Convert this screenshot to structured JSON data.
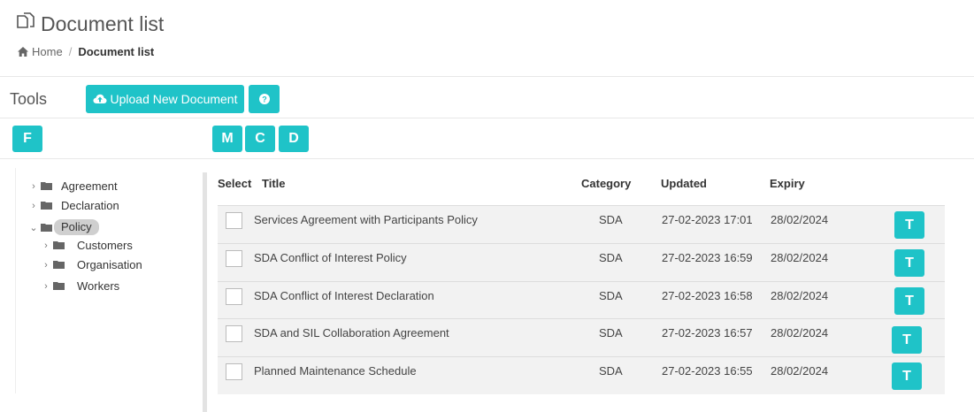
{
  "header": {
    "title": "Document list",
    "icon": "documents-icon"
  },
  "breadcrumb": {
    "home": "Home",
    "separator": "/",
    "current": "Document list"
  },
  "toolbar": {
    "label": "Tools",
    "upload_label": "Upload New Document",
    "upload_icon": "cloud-upload-icon",
    "help_icon": "question-circle-icon",
    "accent_color": "#1fc3c8"
  },
  "filters": {
    "f": "F",
    "m": "M",
    "c": "C",
    "d": "D"
  },
  "tree": {
    "items": [
      {
        "label": "Agreement",
        "expanded": false,
        "selected": false
      },
      {
        "label": "Declaration",
        "expanded": false,
        "selected": false
      },
      {
        "label": "Policy",
        "expanded": true,
        "selected": true
      },
      {
        "label": "Customers",
        "expanded": false,
        "selected": false
      },
      {
        "label": "Organisation",
        "expanded": false,
        "selected": false
      },
      {
        "label": "Workers",
        "expanded": false,
        "selected": false
      }
    ]
  },
  "table": {
    "columns": [
      "Select",
      "Title",
      "Category",
      "Updated",
      "Expiry"
    ],
    "rows": [
      {
        "title": "Services Agreement with Participants Policy",
        "category": "SDA",
        "updated": "27-02-2023 17:01",
        "expiry": "28/02/2024",
        "action": "T"
      },
      {
        "title": "SDA Conflict of Interest Policy",
        "category": "SDA",
        "updated": "27-02-2023 16:59",
        "expiry": "28/02/2024",
        "action": "T"
      },
      {
        "title": "SDA Conflict of Interest Declaration",
        "category": "SDA",
        "updated": "27-02-2023 16:58",
        "expiry": "28/02/2024",
        "action": "T"
      },
      {
        "title": "SDA and SIL Collaboration Agreement",
        "category": "SDA",
        "updated": "27-02-2023 16:57",
        "expiry": "28/02/2024",
        "action": "T"
      },
      {
        "title": "Planned Maintenance Schedule",
        "category": "SDA",
        "updated": "27-02-2023 16:55",
        "expiry": "28/02/2024",
        "action": "T"
      }
    ]
  }
}
